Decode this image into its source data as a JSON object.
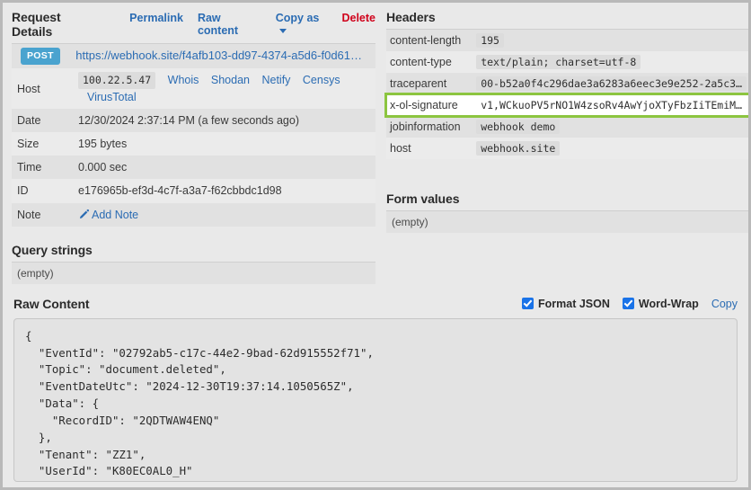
{
  "request_details": {
    "title": "Request Details",
    "actions": [
      {
        "label": "Permalink",
        "name": "permalink-link"
      },
      {
        "label": "Raw content",
        "name": "raw-content-link"
      },
      {
        "label": "Copy as",
        "name": "copy-as-dropdown"
      },
      {
        "label": "Delete",
        "name": "delete-link"
      }
    ],
    "method": "POST",
    "url": "https://webhook.site/f4afb103-dd97-4374-a5d6-f0d61…",
    "rows": [
      {
        "key": "Host",
        "value": "100.22.5.47"
      },
      {
        "key": "Date",
        "value": "12/30/2024 2:37:14 PM (a few seconds ago)"
      },
      {
        "key": "Size",
        "value": "195 bytes"
      },
      {
        "key": "Time",
        "value": "0.000 sec"
      },
      {
        "key": "ID",
        "value": "e176965b-ef3d-4c7f-a3a7-f62cbbdc1d98"
      },
      {
        "key": "Note",
        "value": "Add Note"
      }
    ],
    "host_links": [
      "Whois",
      "Shodan",
      "Netify",
      "Censys",
      "VirusTotal"
    ]
  },
  "query_strings": {
    "title": "Query strings",
    "empty_text": "(empty)"
  },
  "headers": {
    "title": "Headers",
    "rows": [
      {
        "key": "content-length",
        "value": "195",
        "highlight": false
      },
      {
        "key": "content-type",
        "value": "text/plain; charset=utf-8",
        "highlight": false
      },
      {
        "key": "traceparent",
        "value": "00-b52a0f4c296dae3a6283a6eec3e9e252-2a5c3…",
        "highlight": false
      },
      {
        "key": "x-ol-signature",
        "value": "v1,WCkuoPV5rNO1W4zsoRv4AwYjoXTyFbzIiTEmiM…",
        "highlight": true
      },
      {
        "key": "jobinformation",
        "value": "webhook demo",
        "highlight": false
      },
      {
        "key": "host",
        "value": "webhook.site",
        "highlight": false
      }
    ],
    "highlight_color": "#8cc540"
  },
  "form_values": {
    "title": "Form values",
    "empty_text": "(empty)"
  },
  "raw_content": {
    "title": "Raw Content",
    "format_json_label": "Format JSON",
    "format_json_checked": true,
    "word_wrap_label": "Word-Wrap",
    "word_wrap_checked": true,
    "copy_label": "Copy",
    "body": "{\n  \"EventId\": \"02792ab5-c17c-44e2-9bad-62d915552f71\",\n  \"Topic\": \"document.deleted\",\n  \"EventDateUtc\": \"2024-12-30T19:37:14.1050565Z\",\n  \"Data\": {\n    \"RecordID\": \"2QDTWAW4ENQ\"\n  },\n  \"Tenant\": \"ZZ1\",\n  \"UserId\": \"K80EC0AL0_H\"\n}"
  }
}
